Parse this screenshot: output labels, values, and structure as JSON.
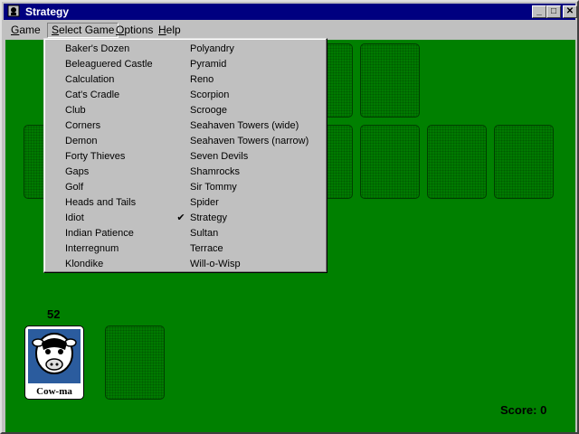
{
  "window": {
    "title": "Strategy",
    "controls": {
      "minimize": "_",
      "maximize": "□",
      "close": "✕"
    }
  },
  "menubar": {
    "items": [
      {
        "label": "Game",
        "mnemonic": "G"
      },
      {
        "label": "Select Game",
        "mnemonic": "S"
      },
      {
        "label": "Options",
        "mnemonic": "O"
      },
      {
        "label": "Help",
        "mnemonic": "H"
      }
    ]
  },
  "select_game_menu": {
    "column1": [
      "Baker's Dozen",
      "Beleaguered Castle",
      "Calculation",
      "Cat's Cradle",
      "Club",
      "Corners",
      "Demon",
      "Forty Thieves",
      "Gaps",
      "Golf",
      "Heads and Tails",
      "Idiot",
      "Indian Patience",
      "Interregnum",
      "Klondike"
    ],
    "column2": [
      "Polyandry",
      "Pyramid",
      "Reno",
      "Scorpion",
      "Scrooge",
      "Seahaven Towers (wide)",
      "Seahaven Towers (narrow)",
      "Seven Devils",
      "Shamrocks",
      "Sir Tommy",
      "Spider",
      "Strategy",
      "Sultan",
      "Terrace",
      "Will-o-Wisp"
    ],
    "checked": "Strategy",
    "check_glyph": "✔"
  },
  "board": {
    "stock_count": "52",
    "deck_back_label": "Cow-ma",
    "score_text": "Score: 0"
  },
  "colors": {
    "felt": "#008000",
    "titlebar": "#000080",
    "menu": "#c0c0c0"
  }
}
